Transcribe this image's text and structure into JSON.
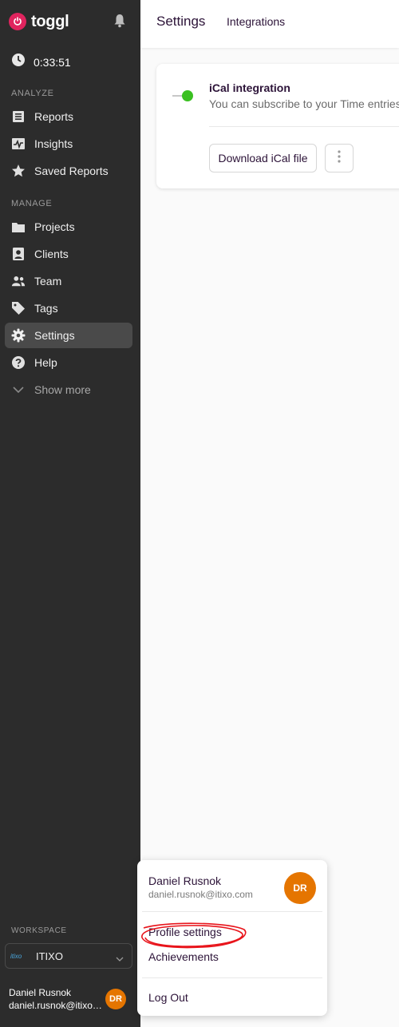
{
  "brand": {
    "name": "toggl"
  },
  "timer": {
    "value": "0:33:51"
  },
  "sidebar": {
    "analyze_label": "ANALYZE",
    "manage_label": "MANAGE",
    "items": [
      {
        "label": "Reports",
        "icon": "reports-icon"
      },
      {
        "label": "Insights",
        "icon": "insights-icon"
      },
      {
        "label": "Saved Reports",
        "icon": "star-icon"
      },
      {
        "label": "Projects",
        "icon": "folder-icon"
      },
      {
        "label": "Clients",
        "icon": "client-icon"
      },
      {
        "label": "Team",
        "icon": "team-icon"
      },
      {
        "label": "Tags",
        "icon": "tag-icon"
      },
      {
        "label": "Settings",
        "icon": "gear-icon",
        "active": true
      },
      {
        "label": "Help",
        "icon": "help-icon"
      },
      {
        "label": "Show more",
        "icon": "chevron-down-icon"
      }
    ],
    "workspace_label": "WORKSPACE",
    "workspace_logo": "itixo",
    "workspace_name": "ITIXO",
    "user_name": "Daniel Rusnok",
    "user_email": "daniel.rusnok@itixo.com",
    "user_initials": "DR"
  },
  "header": {
    "title": "Settings",
    "tab": "Integrations"
  },
  "card": {
    "title": "iCal integration",
    "description": "You can subscribe to your Time entries",
    "download_label": "Download iCal file"
  },
  "menu": {
    "name": "Daniel Rusnok",
    "email": "daniel.rusnok@itixo.com",
    "initials": "DR",
    "profile_settings": "Profile settings",
    "achievements": "Achievements",
    "logout": "Log Out"
  },
  "colors": {
    "sidebar_bg": "#2c2c2c",
    "accent_avatar": "#e57500",
    "toggle_on": "#3ac021",
    "brand_logo": "#e0245e"
  }
}
